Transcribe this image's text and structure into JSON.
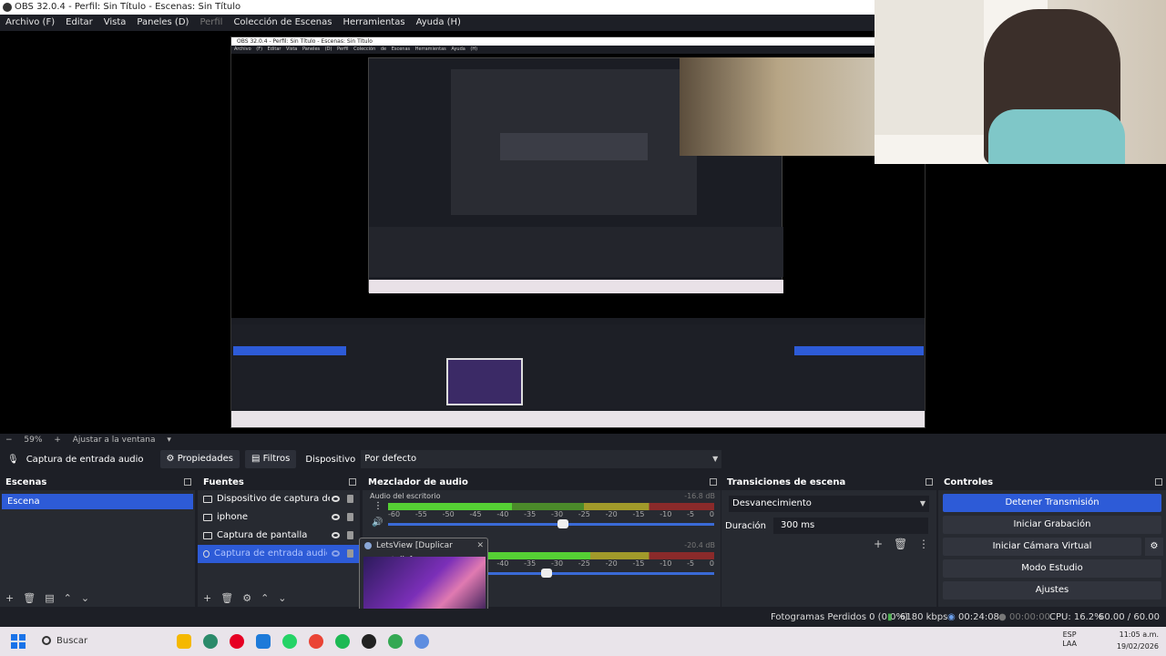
{
  "window": {
    "title": "OBS 32.0.4 - Perfil: Sin Título - Escenas: Sin Título"
  },
  "menu": {
    "items": [
      "Archivo (F)",
      "Editar",
      "Vista",
      "Paneles (D)",
      "Perfil",
      "Colección de Escenas",
      "Herramientas",
      "Ayuda (H)"
    ]
  },
  "preview": {
    "zoom": "59%",
    "fit_label": "Ajustar a la ventana",
    "nested_title": "OBS 32.0.4 - Perfil: Sin Título - Escenas: Sin Título",
    "nested_menu": "Archivo (F) Editar Vista Paneles (D) Perfil Colección de Escenas Herramientas Ayuda (H)"
  },
  "context_bar": {
    "source_name": "Captura de entrada audio",
    "properties": "Propiedades",
    "filters": "Filtros",
    "device_label": "Dispositivo",
    "device_value": "Por defecto"
  },
  "scenes": {
    "title": "Escenas",
    "items": [
      "Escena"
    ]
  },
  "sources": {
    "title": "Fuentes",
    "items": [
      {
        "label": "Dispositivo de captura de vide",
        "icon": "camera-icon"
      },
      {
        "label": "iphone",
        "icon": "window-icon"
      },
      {
        "label": "Captura de pantalla",
        "icon": "monitor-icon"
      },
      {
        "label": "Captura de entrada audio",
        "icon": "microphone-icon"
      }
    ]
  },
  "mixer": {
    "title": "Mezclador de audio",
    "channels": [
      {
        "name": "Audio del escritorio",
        "db": "-16.8 dB",
        "level": 0.38
      },
      {
        "name": "",
        "db": "-20.4 dB",
        "level": 0.62
      }
    ],
    "scale": [
      "-60",
      "-55",
      "-50",
      "-45",
      "-40",
      "-35",
      "-30",
      "-25",
      "-20",
      "-15",
      "-10",
      "-5",
      "0"
    ]
  },
  "thumbnail": {
    "title": "LetsView [Duplicar pantalla]"
  },
  "transitions": {
    "title": "Transiciones de escena",
    "selected": "Desvanecimiento",
    "duration_label": "Duración",
    "duration_value": "300 ms"
  },
  "controls": {
    "title": "Controles",
    "buttons": [
      "Detener Transmisión",
      "Iniciar Grabación",
      "Iniciar Cámara Virtual",
      "Modo Estudio",
      "Ajustes"
    ]
  },
  "status": {
    "dropped": "Fotogramas Perdidos 0 (0.0%)",
    "bitrate": "6180 kbps",
    "live_time": "00:24:08",
    "rec_time": "00:00:00",
    "cpu": "CPU: 16.2%",
    "fps": "60.00 / 60.00 FPS"
  },
  "taskbar": {
    "search": "Buscar",
    "lang_top": "ESP",
    "lang_bottom": "LAA",
    "time": "11:05 a.m.",
    "date": "19/02/2026"
  },
  "colors": {
    "accent": "#2d5bd7",
    "panel": "#272a31",
    "bg": "#1d1f26"
  }
}
